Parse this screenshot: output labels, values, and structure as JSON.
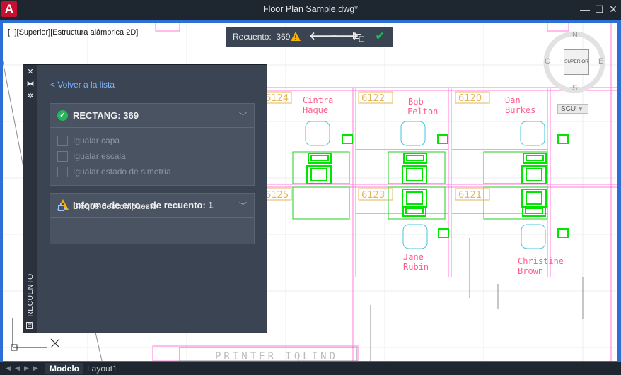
{
  "window": {
    "title": "Floor Plan Sample.dwg*",
    "logo": "A",
    "minimize": "—",
    "maximize": "☐",
    "close": "✕"
  },
  "viewport": {
    "label": "[−][Superior][Estructura alámbrica 2D]"
  },
  "count_toolbar": {
    "label": "Recuento:",
    "count": "369"
  },
  "panel": {
    "title": "RECUENTO",
    "back_link": "< Volver a la lista",
    "rectang": {
      "title": "RECTANG: 369",
      "options": [
        "Igualar capa",
        "Igualar escala",
        "Igualar estado de simetría"
      ]
    },
    "error": {
      "title": "Informe de erro... de recuento: 1",
      "item": "Bloque descompuesto"
    }
  },
  "drawing": {
    "rooms": [
      "6124",
      "6122",
      "6120",
      "6125",
      "6123",
      "6121"
    ],
    "people": [
      {
        "first": "Cintra",
        "last": "Haque"
      },
      {
        "first": "Bob",
        "last": "Felton"
      },
      {
        "first": "Dan",
        "last": "Burkes"
      },
      {
        "first": "Jane",
        "last": "Rubin"
      },
      {
        "first": "Christine",
        "last": "Brown"
      }
    ],
    "bottom_text": "PRINTER IQLIND"
  },
  "navcube": {
    "face": "SUPERIOR",
    "north": "N",
    "south": "S",
    "east": "E",
    "west": "O",
    "ucs": "SCU"
  },
  "tabs": {
    "model": "Modelo",
    "layout": "Layout1"
  },
  "colors": {
    "accent": "#2c6fd6",
    "panel": "#3b4453",
    "link": "#7cb4ff",
    "success": "#27b55b",
    "warning": "#f5b400",
    "drawing_green": "#00e600",
    "drawing_magenta": "#ff7ad9"
  }
}
